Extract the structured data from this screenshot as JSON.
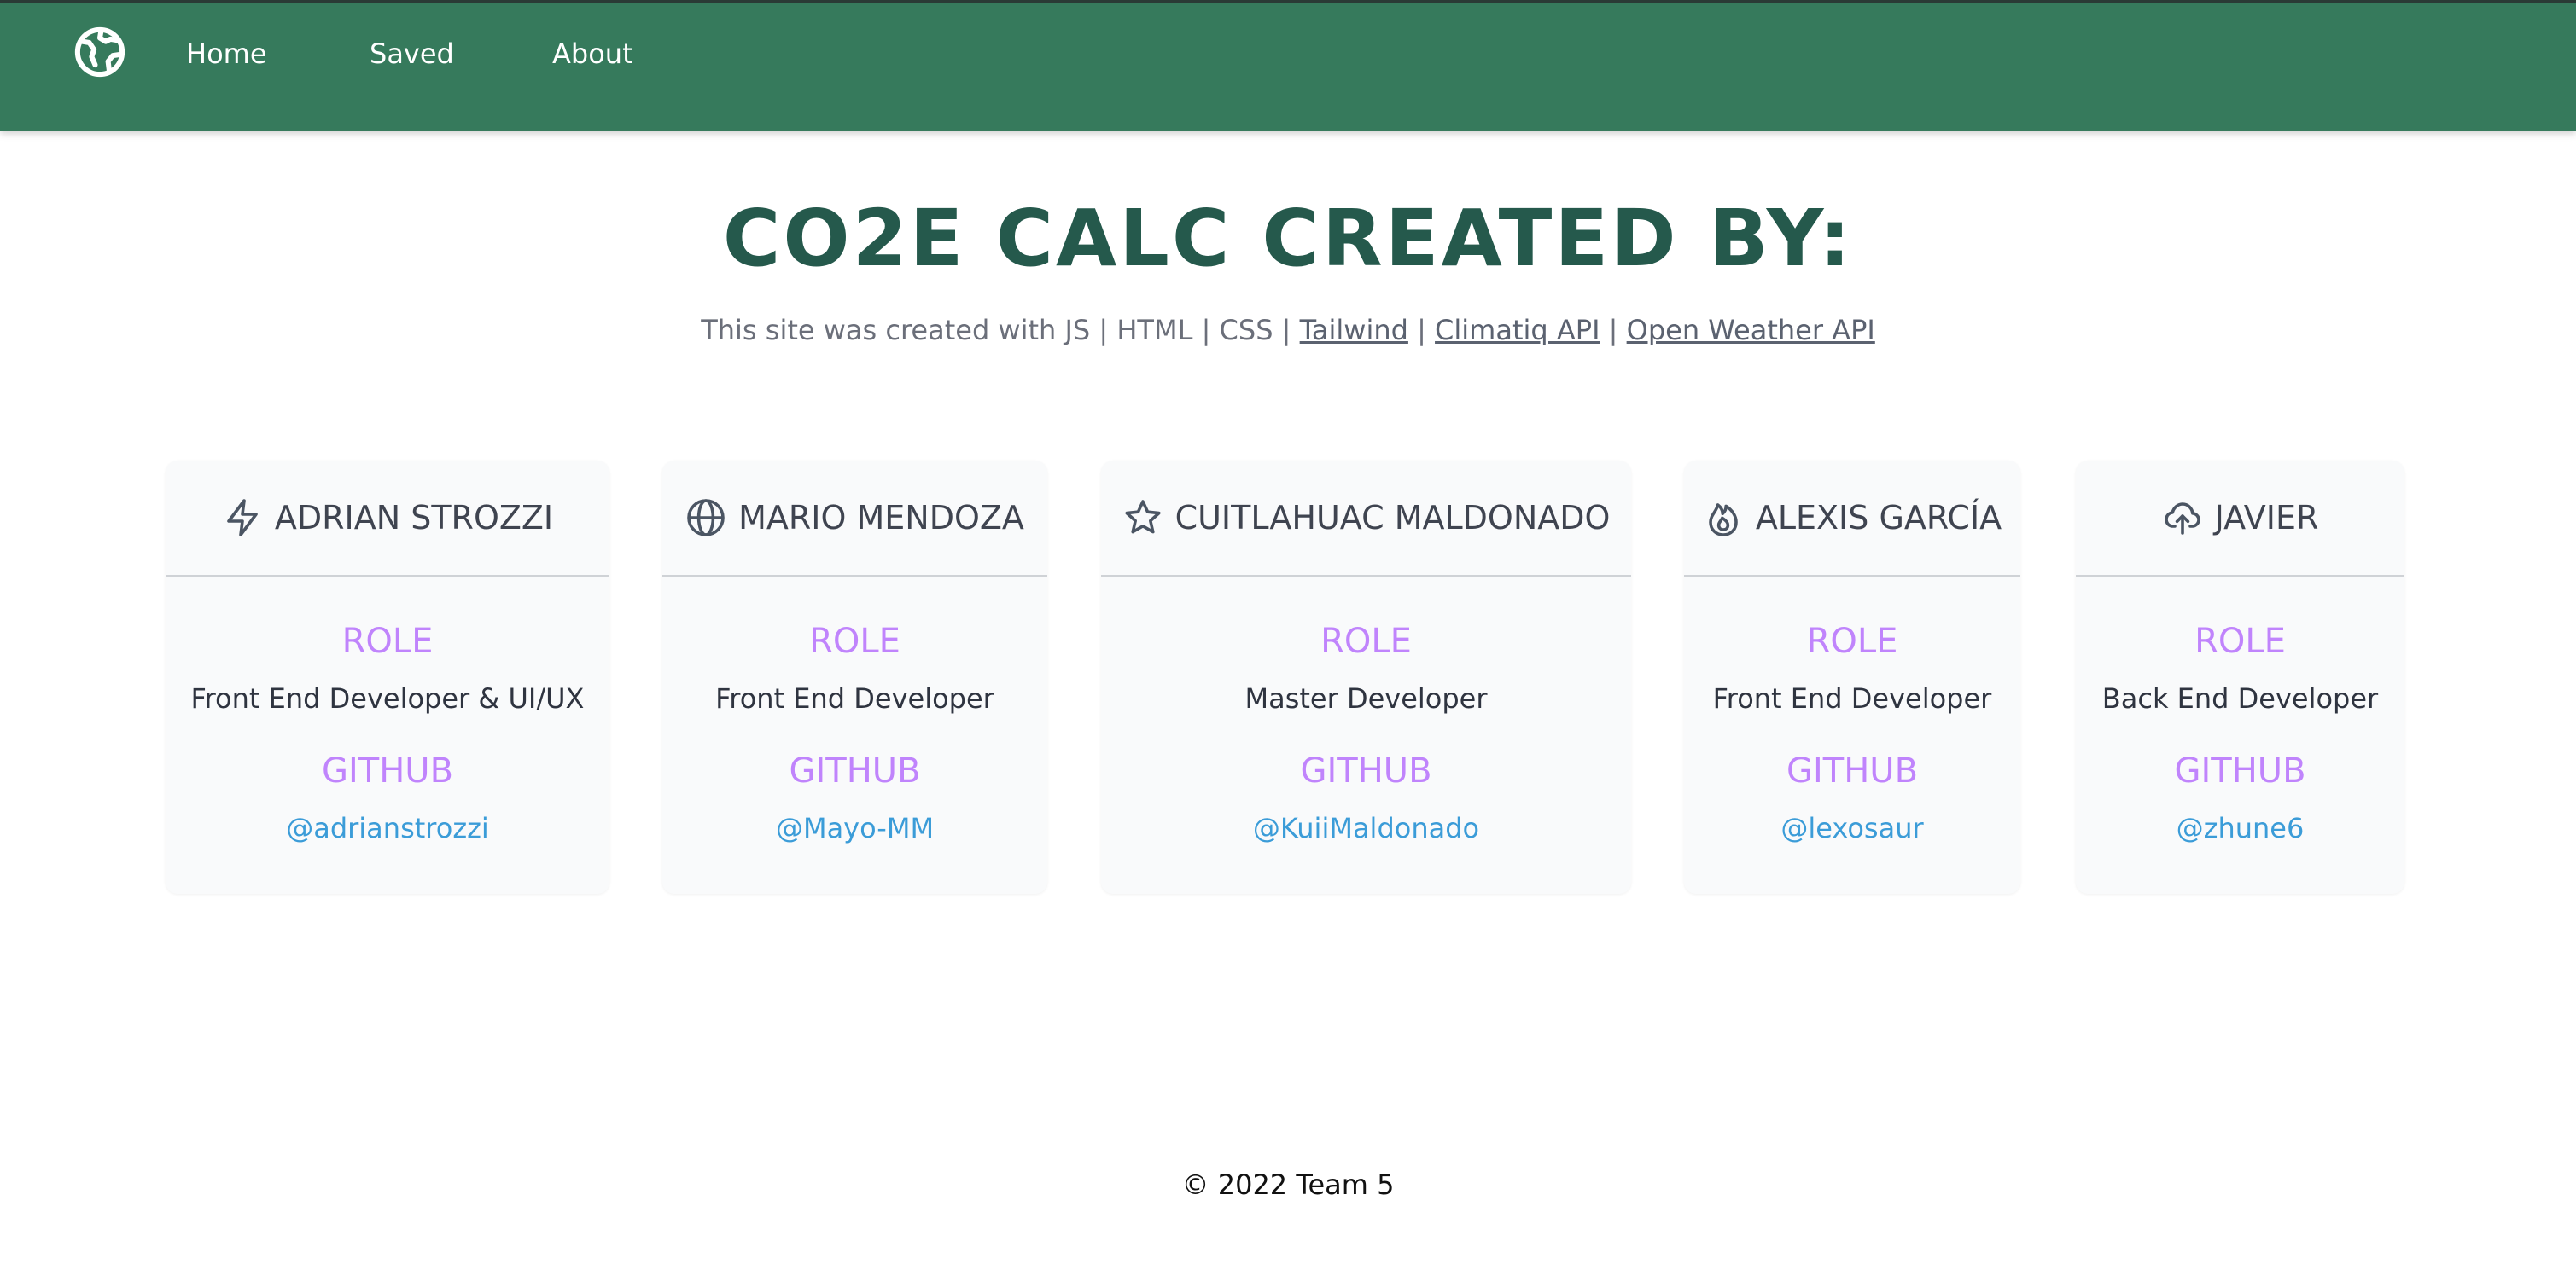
{
  "nav": {
    "logo_icon": "globe-americas-icon",
    "links": [
      "Home",
      "Saved",
      "About"
    ]
  },
  "hero": {
    "title": "CO2E CALC CREATED BY:",
    "credits_prefix": "This site was created with JS | HTML | CSS |",
    "separator": "|",
    "links": [
      "Tailwind",
      "Climatiq API",
      "Open Weather API"
    ]
  },
  "labels": {
    "role": "ROLE",
    "github": "GITHUB"
  },
  "team": [
    {
      "name": "ADRIAN STROZZI",
      "icon": "lightning-bolt-icon",
      "role": "Front End Developer & UI/UX",
      "github": "@adrianstrozzi"
    },
    {
      "name": "MARIO MENDOZA",
      "icon": "globe-icon",
      "role": "Front End Developer",
      "github": "@Mayo-MM"
    },
    {
      "name": "CUITLAHUAC MALDONADO",
      "icon": "star-icon",
      "role": "Master Developer",
      "github": "@KuiiMaldonado"
    },
    {
      "name": "ALEXIS GARCÍA",
      "icon": "fire-icon",
      "role": "Front End Developer",
      "github": "@lexosaur"
    },
    {
      "name": "JAVIER",
      "icon": "cloud-upload-icon",
      "role": "Back End Developer",
      "github": "@zhune6"
    }
  ],
  "footer": {
    "text": "© 2022 Team 5"
  },
  "colors": {
    "navbar": "#367a5c",
    "title": "#25594c",
    "label_accent": "#c084fc",
    "github_link": "#3b9cd8",
    "card_bg": "#f9fafb"
  }
}
